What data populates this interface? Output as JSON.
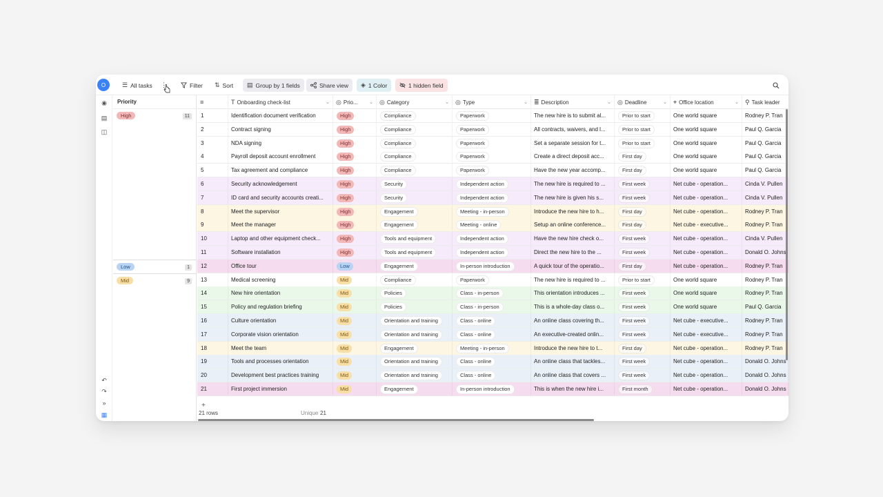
{
  "toolbar": {
    "view_name": "All tasks",
    "filter": "Filter",
    "sort": "Sort",
    "group": "Group by 1 fields",
    "share": "Share view",
    "color": "1 Color",
    "hidden": "1 hidden field",
    "avatar_initial": "O"
  },
  "groups": {
    "header": "Priority",
    "items": [
      {
        "label": "High",
        "count": "11"
      },
      {
        "label": "Low",
        "count": "1"
      },
      {
        "label": "Mid",
        "count": "9"
      }
    ]
  },
  "columns": [
    "Onboarding check-list",
    "Prio...",
    "Category",
    "Type",
    "Description",
    "Deadline",
    "Office location",
    "Task leader"
  ],
  "rows": [
    {
      "n": "1",
      "task": "Identification document verification",
      "prio": "High",
      "cat": "Compliance",
      "type": "Paperwork",
      "desc": "The new hire is to submit al...",
      "deadline": "Prior to start",
      "office": "One world square",
      "leader": "Rodney P. Tran"
    },
    {
      "n": "2",
      "task": "Contract signing",
      "prio": "High",
      "cat": "Compliance",
      "type": "Paperwork",
      "desc": "All contracts, waivers, and l...",
      "deadline": "Prior to start",
      "office": "One world square",
      "leader": "Paul Q. Garcia"
    },
    {
      "n": "3",
      "task": "NDA signing",
      "prio": "High",
      "cat": "Compliance",
      "type": "Paperwork",
      "desc": "Set a separate session for t...",
      "deadline": "Prior to start",
      "office": "One world square",
      "leader": "Paul Q. Garcia"
    },
    {
      "n": "4",
      "task": "Payroll deposit account enrollment",
      "prio": "High",
      "cat": "Compliance",
      "type": "Paperwork",
      "desc": "Create a direct deposit acc...",
      "deadline": "First day",
      "office": "One world square",
      "leader": "Paul Q. Garcia"
    },
    {
      "n": "5",
      "task": "Tax agreement and compliance",
      "prio": "High",
      "cat": "Compliance",
      "type": "Paperwork",
      "desc": "Have the new year accomp...",
      "deadline": "First day",
      "office": "One world square",
      "leader": "Paul Q. Garcia"
    },
    {
      "n": "6",
      "task": "Security acknowledgement",
      "prio": "High",
      "cat": "Security",
      "type": "Independent action",
      "desc": "The new hire is required to ...",
      "deadline": "First week",
      "office": "Net cube - operation...",
      "leader": "Cinda V. Pullen"
    },
    {
      "n": "7",
      "task": "ID card and security accounts creati...",
      "prio": "High",
      "cat": "Security",
      "type": "Independent action",
      "desc": "The new hire is given his s...",
      "deadline": "First week",
      "office": "Net cube - operation...",
      "leader": "Cinda V. Pullen"
    },
    {
      "n": "8",
      "task": "Meet the supervisor",
      "prio": "High",
      "cat": "Engagement",
      "type": "Meeting - in-person",
      "desc": "Introduce the new hire to h...",
      "deadline": "First day",
      "office": "Net cube - operation...",
      "leader": "Rodney P. Tran"
    },
    {
      "n": "9",
      "task": "Meet the manager",
      "prio": "High",
      "cat": "Engagement",
      "type": "Meeting - online",
      "desc": "Setup an online conference...",
      "deadline": "First day",
      "office": "Net cube - executive...",
      "leader": "Rodney P. Tran"
    },
    {
      "n": "10",
      "task": "Laptop and other equipment check...",
      "prio": "High",
      "cat": "Tools and equipment",
      "type": "Independent action",
      "desc": "Have the new hire check o...",
      "deadline": "First week",
      "office": "Net cube - operation...",
      "leader": "Cinda V. Pullen"
    },
    {
      "n": "11",
      "task": "Software installation",
      "prio": "High",
      "cat": "Tools and equipment",
      "type": "Independent action",
      "desc": "Direct the new hire to the ...",
      "deadline": "First week",
      "office": "Net cube - operation...",
      "leader": "Donald O. Johns"
    },
    {
      "n": "12",
      "task": "Office tour",
      "prio": "Low",
      "cat": "Engagement",
      "type": "In-person introduction",
      "desc": "A quick tour of the operatio...",
      "deadline": "First day",
      "office": "Net cube - operation...",
      "leader": "Rodney P. Tran"
    },
    {
      "n": "13",
      "task": "Medical screening",
      "prio": "Mid",
      "cat": "Compliance",
      "type": "Paperwork",
      "desc": "The new hire is required to ...",
      "deadline": "Prior to start",
      "office": "One world square",
      "leader": "Rodney P. Tran"
    },
    {
      "n": "14",
      "task": "New hire orientation",
      "prio": "Mid",
      "cat": "Policies",
      "type": "Class - in-person",
      "desc": "This orientation introduces ...",
      "deadline": "First week",
      "office": "One world square",
      "leader": "Rodney P. Tran"
    },
    {
      "n": "15",
      "task": "Policy and regulation briefing",
      "prio": "Mid",
      "cat": "Policies",
      "type": "Class - in-person",
      "desc": "This is a whole-day class o...",
      "deadline": "First week",
      "office": "One world square",
      "leader": "Paul Q. Garcia"
    },
    {
      "n": "16",
      "task": "Culture orientation",
      "prio": "Mid",
      "cat": "Orientation and training",
      "type": "Class - online",
      "desc": "An online class covering th...",
      "deadline": "First week",
      "office": "Net cube - executive...",
      "leader": "Rodney P. Tran"
    },
    {
      "n": "17",
      "task": "Corporate vision orientation",
      "prio": "Mid",
      "cat": "Orientation and training",
      "type": "Class - online",
      "desc": "An executive-created onlin...",
      "deadline": "First week",
      "office": "Net cube - executive...",
      "leader": "Rodney P. Tran"
    },
    {
      "n": "18",
      "task": "Meet the team",
      "prio": "Mid",
      "cat": "Engagement",
      "type": "Meeting - in-person",
      "desc": "Introduce the new hire to t...",
      "deadline": "First day",
      "office": "Net cube - operation...",
      "leader": "Rodney P. Tran"
    },
    {
      "n": "19",
      "task": "Tools and processes orientation",
      "prio": "Mid",
      "cat": "Orientation and training",
      "type": "Class - online",
      "desc": "An online class that tackles...",
      "deadline": "First week",
      "office": "Net cube - operation...",
      "leader": "Donald O. Johns"
    },
    {
      "n": "20",
      "task": "Development best practices training",
      "prio": "Mid",
      "cat": "Orientation and training",
      "type": "Class - online",
      "desc": "An online class that covers ...",
      "deadline": "First week",
      "office": "Net cube - operation...",
      "leader": "Donald O. Johns"
    },
    {
      "n": "21",
      "task": "First project immersion",
      "prio": "Mid",
      "cat": "Engagement",
      "type": "In-person introduction",
      "desc": "This is when the new hire i...",
      "deadline": "First month",
      "office": "Net cube - operation...",
      "leader": "Donald O. Johns"
    }
  ],
  "footer": {
    "rows": "21 rows",
    "unique_label": "Unique",
    "unique_value": "21",
    "add": "+"
  },
  "colors": {
    "prio_high": "#f2b8b8",
    "prio_low": "#b9d3f3",
    "prio_mid": "#f8dfa8",
    "row_compliance": "#ffffff",
    "row_security": "#f6ebfa",
    "row_engagement": "#fdf6e3",
    "row_tools": "#f6ebfa",
    "row_inperson": "#f6dcef",
    "row_policies": "#eaf8ea",
    "row_orientation": "#eaf0f8"
  }
}
